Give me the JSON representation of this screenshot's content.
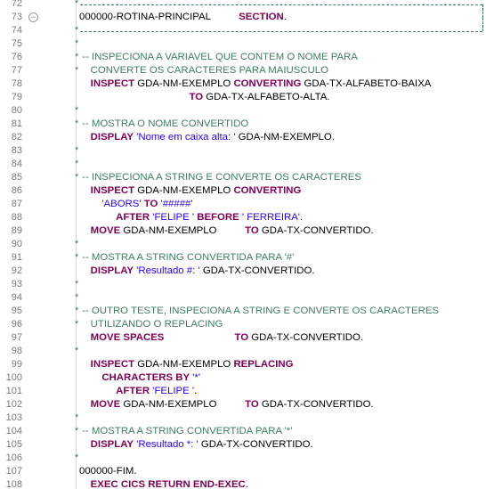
{
  "editor": {
    "lines": [
      {
        "n": "72",
        "fold": false,
        "star": true,
        "box": "top",
        "segs": []
      },
      {
        "n": "73",
        "fold": true,
        "star": false,
        "segs": [
          {
            "t": "000000-ROTINA-PRINCIPAL          ",
            "c": "pl"
          },
          {
            "t": "SECTION",
            "c": "kw"
          },
          {
            "t": ".",
            "c": "pl"
          }
        ]
      },
      {
        "n": "74",
        "fold": false,
        "star": true,
        "box": "bottom",
        "segs": []
      },
      {
        "n": "75",
        "fold": false,
        "star": true,
        "segs": []
      },
      {
        "n": "76",
        "fold": false,
        "star": true,
        "segs": [
          {
            "t": " -- INSPECIONA A VARIAVEL QUE CONTEM O NOME PARA",
            "c": "cm"
          }
        ]
      },
      {
        "n": "77",
        "fold": false,
        "star": true,
        "segs": [
          {
            "t": "    CONVERTE OS CARACTERES PARA MAIUSCULO",
            "c": "cm"
          }
        ]
      },
      {
        "n": "78",
        "fold": false,
        "star": false,
        "segs": [
          {
            "t": "    ",
            "c": "pl"
          },
          {
            "t": "INSPECT",
            "c": "kw"
          },
          {
            "t": " GDA-NM-EXEMPLO ",
            "c": "pl"
          },
          {
            "t": "CONVERTING",
            "c": "kw"
          },
          {
            "t": " GDA-TX-ALFABETO-BAIXA",
            "c": "pl"
          }
        ]
      },
      {
        "n": "79",
        "fold": false,
        "star": false,
        "segs": [
          {
            "t": "                                       ",
            "c": "pl"
          },
          {
            "t": "TO",
            "c": "kw"
          },
          {
            "t": " GDA-TX-ALFABETO-ALTA.",
            "c": "pl"
          }
        ]
      },
      {
        "n": "80",
        "fold": false,
        "star": true,
        "segs": []
      },
      {
        "n": "81",
        "fold": false,
        "star": true,
        "segs": [
          {
            "t": " -- MOSTRA O NOME CONVERTIDO",
            "c": "cm"
          }
        ]
      },
      {
        "n": "82",
        "fold": false,
        "star": false,
        "segs": [
          {
            "t": "    ",
            "c": "pl"
          },
          {
            "t": "DISPLAY",
            "c": "kw"
          },
          {
            "t": " ",
            "c": "pl"
          },
          {
            "t": "'Nome em caixa alta: '",
            "c": "str"
          },
          {
            "t": " GDA-NM-EXEMPLO.",
            "c": "pl"
          }
        ]
      },
      {
        "n": "83",
        "fold": false,
        "star": true,
        "segs": []
      },
      {
        "n": "84",
        "fold": false,
        "star": true,
        "segs": []
      },
      {
        "n": "85",
        "fold": false,
        "star": true,
        "segs": [
          {
            "t": " -- INSPECIONA A STRING E CONVERTE OS CARACTERES",
            "c": "cm"
          }
        ]
      },
      {
        "n": "86",
        "fold": false,
        "star": false,
        "segs": [
          {
            "t": "    ",
            "c": "pl"
          },
          {
            "t": "INSPECT",
            "c": "kw"
          },
          {
            "t": " GDA-NM-EXEMPLO ",
            "c": "pl"
          },
          {
            "t": "CONVERTING",
            "c": "kw"
          }
        ]
      },
      {
        "n": "87",
        "fold": false,
        "star": false,
        "segs": [
          {
            "t": "        ",
            "c": "pl"
          },
          {
            "t": "'ABORS'",
            "c": "str"
          },
          {
            "t": " ",
            "c": "pl"
          },
          {
            "t": "TO",
            "c": "kw"
          },
          {
            "t": " ",
            "c": "pl"
          },
          {
            "t": "'#####'",
            "c": "str"
          }
        ]
      },
      {
        "n": "88",
        "fold": false,
        "star": false,
        "segs": [
          {
            "t": "             ",
            "c": "pl"
          },
          {
            "t": "AFTER",
            "c": "kw"
          },
          {
            "t": " ",
            "c": "pl"
          },
          {
            "t": "'FELIPE '",
            "c": "str"
          },
          {
            "t": " ",
            "c": "pl"
          },
          {
            "t": "BEFORE",
            "c": "kw"
          },
          {
            "t": " ",
            "c": "pl"
          },
          {
            "t": "' FERREIRA'",
            "c": "str"
          },
          {
            "t": ".",
            "c": "pl"
          }
        ]
      },
      {
        "n": "89",
        "fold": false,
        "star": false,
        "segs": [
          {
            "t": "    ",
            "c": "pl"
          },
          {
            "t": "MOVE",
            "c": "kw"
          },
          {
            "t": " GDA-NM-EXEMPLO          ",
            "c": "pl"
          },
          {
            "t": "TO",
            "c": "kw"
          },
          {
            "t": " GDA-TX-CONVERTIDO.",
            "c": "pl"
          }
        ]
      },
      {
        "n": "90",
        "fold": false,
        "star": true,
        "segs": []
      },
      {
        "n": "91",
        "fold": false,
        "star": true,
        "segs": [
          {
            "t": " -- MOSTRA A STRING CONVERTIDA PARA '#'",
            "c": "cm"
          }
        ]
      },
      {
        "n": "92",
        "fold": false,
        "star": false,
        "segs": [
          {
            "t": "    ",
            "c": "pl"
          },
          {
            "t": "DISPLAY",
            "c": "kw"
          },
          {
            "t": " ",
            "c": "pl"
          },
          {
            "t": "'Resultado #: '",
            "c": "str"
          },
          {
            "t": " GDA-TX-CONVERTIDO.",
            "c": "pl"
          }
        ]
      },
      {
        "n": "93",
        "fold": false,
        "star": true,
        "segs": []
      },
      {
        "n": "94",
        "fold": false,
        "star": true,
        "segs": []
      },
      {
        "n": "95",
        "fold": false,
        "star": true,
        "segs": [
          {
            "t": " -- OUTRO TESTE, INSPECIONA A STRING E CONVERTE OS CARACTERES",
            "c": "cm"
          }
        ]
      },
      {
        "n": "96",
        "fold": false,
        "star": true,
        "segs": [
          {
            "t": "    UTILIZANDO O REPLACING",
            "c": "cm"
          }
        ]
      },
      {
        "n": "97",
        "fold": false,
        "star": false,
        "segs": [
          {
            "t": "    ",
            "c": "pl"
          },
          {
            "t": "MOVE",
            "c": "kw"
          },
          {
            "t": " ",
            "c": "pl"
          },
          {
            "t": "SPACES",
            "c": "kw"
          },
          {
            "t": "                         ",
            "c": "pl"
          },
          {
            "t": "TO",
            "c": "kw"
          },
          {
            "t": " GDA-TX-CONVERTIDO.",
            "c": "pl"
          }
        ]
      },
      {
        "n": "98",
        "fold": false,
        "star": true,
        "segs": []
      },
      {
        "n": "99",
        "fold": false,
        "star": false,
        "segs": [
          {
            "t": "    ",
            "c": "pl"
          },
          {
            "t": "INSPECT",
            "c": "kw"
          },
          {
            "t": " GDA-NM-EXEMPLO ",
            "c": "pl"
          },
          {
            "t": "REPLACING",
            "c": "kw"
          }
        ]
      },
      {
        "n": "100",
        "fold": false,
        "star": false,
        "segs": [
          {
            "t": "        ",
            "c": "pl"
          },
          {
            "t": "CHARACTERS",
            "c": "kw"
          },
          {
            "t": " ",
            "c": "pl"
          },
          {
            "t": "BY",
            "c": "kw"
          },
          {
            "t": " ",
            "c": "pl"
          },
          {
            "t": "'*'",
            "c": "str"
          }
        ]
      },
      {
        "n": "101",
        "fold": false,
        "star": false,
        "segs": [
          {
            "t": "             ",
            "c": "pl"
          },
          {
            "t": "AFTER",
            "c": "kw"
          },
          {
            "t": " ",
            "c": "pl"
          },
          {
            "t": "'FELIPE '",
            "c": "str"
          },
          {
            "t": ".",
            "c": "pl"
          }
        ]
      },
      {
        "n": "102",
        "fold": false,
        "star": false,
        "segs": [
          {
            "t": "    ",
            "c": "pl"
          },
          {
            "t": "MOVE",
            "c": "kw"
          },
          {
            "t": " GDA-NM-EXEMPLO          ",
            "c": "pl"
          },
          {
            "t": "TO",
            "c": "kw"
          },
          {
            "t": " GDA-TX-CONVERTIDO.",
            "c": "pl"
          }
        ]
      },
      {
        "n": "103",
        "fold": false,
        "star": true,
        "segs": []
      },
      {
        "n": "104",
        "fold": false,
        "star": true,
        "segs": [
          {
            "t": " -- MOSTRA A STRING CONVERTIDA PARA '*'",
            "c": "cm"
          }
        ]
      },
      {
        "n": "105",
        "fold": false,
        "star": false,
        "segs": [
          {
            "t": "    ",
            "c": "pl"
          },
          {
            "t": "DISPLAY",
            "c": "kw"
          },
          {
            "t": " ",
            "c": "pl"
          },
          {
            "t": "'Resultado *: '",
            "c": "str"
          },
          {
            "t": " GDA-TX-CONVERTIDO.",
            "c": "pl"
          }
        ]
      },
      {
        "n": "106",
        "fold": false,
        "star": true,
        "segs": []
      },
      {
        "n": "107",
        "fold": false,
        "star": false,
        "segs": [
          {
            "t": "000000-FIM.",
            "c": "pl"
          }
        ]
      },
      {
        "n": "108",
        "fold": false,
        "star": false,
        "segs": [
          {
            "t": "    ",
            "c": "pl"
          },
          {
            "t": "EXEC",
            "c": "kw"
          },
          {
            "t": " ",
            "c": "pl"
          },
          {
            "t": "CICS",
            "c": "kw"
          },
          {
            "t": " ",
            "c": "pl"
          },
          {
            "t": "RETURN",
            "c": "kw"
          },
          {
            "t": " ",
            "c": "pl"
          },
          {
            "t": "END-EXEC",
            "c": "kw"
          },
          {
            "t": ".",
            "c": "pl"
          }
        ]
      }
    ],
    "fold_glyph": "−",
    "comment_marker": "*",
    "colors": {
      "keyword": "#7f0055",
      "comment": "#3f7f5f",
      "string": "#2a00ff",
      "line_number": "#7a7a7a"
    }
  }
}
